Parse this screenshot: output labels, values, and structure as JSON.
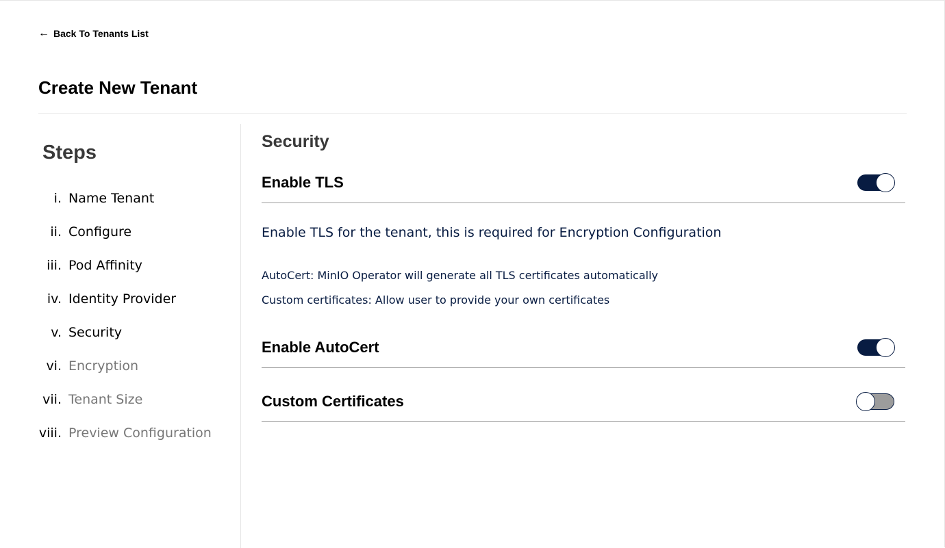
{
  "header": {
    "back_label": "Back To Tenants List",
    "back_icon": "arrow-left-icon",
    "page_title": "Create New Tenant"
  },
  "sidebar": {
    "title": "Steps",
    "steps": [
      {
        "num": "i.",
        "label": "Name Tenant",
        "enabled": true
      },
      {
        "num": "ii.",
        "label": "Configure",
        "enabled": true
      },
      {
        "num": "iii.",
        "label": "Pod Affinity",
        "enabled": true
      },
      {
        "num": "iv.",
        "label": "Identity Provider",
        "enabled": true
      },
      {
        "num": "v.",
        "label": "Security",
        "enabled": true
      },
      {
        "num": "vi.",
        "label": "Encryption",
        "enabled": false
      },
      {
        "num": "vii.",
        "label": "Tenant Size",
        "enabled": false
      },
      {
        "num": "viii.",
        "label": "Preview Configuration",
        "enabled": false
      }
    ]
  },
  "main": {
    "section_title": "Security",
    "enable_tls": {
      "label": "Enable TLS",
      "checked": true
    },
    "tls_description": "Enable TLS for the tenant, this is required for Encryption Configuration",
    "autocert_note": "AutoCert: MinIO Operator will generate all TLS certificates automatically",
    "custom_note": "Custom certificates: Allow user to provide your own certificates",
    "enable_autocert": {
      "label": "Enable AutoCert",
      "checked": true
    },
    "custom_certificates": {
      "label": "Custom Certificates",
      "checked": false
    }
  },
  "colors": {
    "accent": "#081c42",
    "toggle_off": "#9c9c9c",
    "inactive_step": "#777777"
  }
}
